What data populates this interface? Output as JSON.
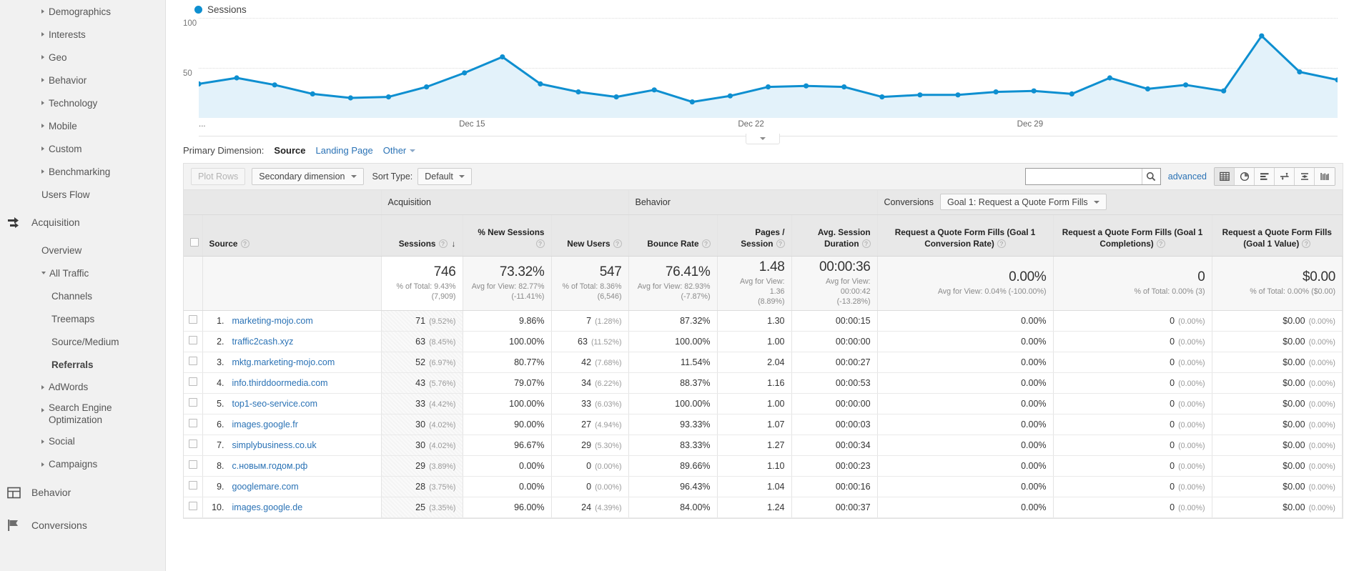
{
  "sidebar": {
    "top_items": [
      {
        "label": "Demographics",
        "arrow": "right"
      },
      {
        "label": "Interests",
        "arrow": "right"
      },
      {
        "label": "Geo",
        "arrow": "right"
      },
      {
        "label": "Behavior",
        "arrow": "right"
      },
      {
        "label": "Technology",
        "arrow": "right"
      },
      {
        "label": "Mobile",
        "arrow": "right"
      },
      {
        "label": "Custom",
        "arrow": "right"
      },
      {
        "label": "Benchmarking",
        "arrow": "right"
      }
    ],
    "users_flow": "Users Flow",
    "acquisition": {
      "label": "Acquisition",
      "icon": "acquisition-arrows-icon",
      "overview": "Overview",
      "all_traffic": "All Traffic",
      "all_traffic_children": [
        "Channels",
        "Treemaps",
        "Source/Medium",
        "Referrals"
      ],
      "active_child": "Referrals",
      "collapsed": [
        {
          "label": "AdWords"
        },
        {
          "label": "Search Engine Optimization"
        },
        {
          "label": "Social"
        },
        {
          "label": "Campaigns"
        }
      ]
    },
    "behavior": {
      "label": "Behavior",
      "icon": "behavior-layout-icon"
    },
    "conversions": {
      "label": "Conversions",
      "icon": "conversions-flag-icon"
    }
  },
  "chart_data": {
    "type": "area",
    "title": "",
    "legend": [
      "Sessions"
    ],
    "legend_position": "top-left",
    "series_color": "#0e8fd0",
    "fill_color": "#e3f2fa",
    "ylabel": "",
    "xlabel": "",
    "ylim": [
      0,
      100
    ],
    "yticks": [
      50,
      100
    ],
    "ytick_labels": [
      "50",
      "100"
    ],
    "grid": true,
    "xtick_labels": [
      "...",
      "Dec 15",
      "Dec 22",
      "Dec 29"
    ],
    "xtick_positions_pct": [
      0,
      24.0,
      48.5,
      73.0
    ],
    "x": [
      1,
      2,
      3,
      4,
      5,
      6,
      7,
      8,
      9,
      10,
      11,
      12,
      13,
      14,
      15,
      16,
      17,
      18,
      19,
      20,
      21,
      22,
      23,
      24,
      25,
      26,
      27,
      28,
      29,
      30,
      31
    ],
    "values": [
      34,
      40,
      33,
      24,
      20,
      21,
      31,
      45,
      61,
      34,
      26,
      21,
      28,
      16,
      22,
      31,
      32,
      31,
      21,
      23,
      23,
      26,
      27,
      24,
      40,
      29,
      33,
      27,
      82,
      46,
      38
    ]
  },
  "primary_dimension": {
    "label": "Primary Dimension:",
    "active": "Source",
    "links": [
      "Landing Page"
    ],
    "other": "Other"
  },
  "toolbar": {
    "plot_rows": "Plot Rows",
    "secondary_dimension": "Secondary dimension",
    "sort_type_label": "Sort Type:",
    "sort_type_value": "Default",
    "search_value": "",
    "search_placeholder": "",
    "advanced": "advanced",
    "view_icons": [
      "table-view-icon",
      "pie-chart-view-icon",
      "performance-bar-view-icon",
      "comparison-view-icon",
      "pivot-view-icon",
      "term-cloud-view-icon"
    ],
    "selected_view": "table-view-icon"
  },
  "table": {
    "group_headers": [
      {
        "label": "Acquisition"
      },
      {
        "label": "Behavior"
      },
      {
        "label": "Conversions",
        "select": "Goal 1: Request a Quote Form Fills"
      }
    ],
    "columns": [
      {
        "label": "Source",
        "help": true,
        "align": "left"
      },
      {
        "label": "Sessions",
        "help": true,
        "sorted": true
      },
      {
        "label": "% New Sessions",
        "help": true
      },
      {
        "label": "New Users",
        "help": true
      },
      {
        "label": "Bounce Rate",
        "help": true
      },
      {
        "label": "Pages / Session",
        "help": true
      },
      {
        "label": "Avg. Session Duration",
        "help": true
      },
      {
        "label": "Request a Quote Form Fills (Goal 1 Conversion Rate)",
        "help": true
      },
      {
        "label": "Request a Quote Form Fills (Goal 1 Completions)",
        "help": true
      },
      {
        "label": "Request a Quote Form Fills (Goal 1 Value)",
        "help": true
      }
    ],
    "summary": [
      {
        "value": "746",
        "sub": "% of Total: 9.43%\n(7,909)"
      },
      {
        "value": "73.32%",
        "sub": "Avg for View: 82.77%\n(-11.41%)"
      },
      {
        "value": "547",
        "sub": "% of Total: 8.36%\n(6,546)"
      },
      {
        "value": "76.41%",
        "sub": "Avg for View: 82.93%\n(-7.87%)"
      },
      {
        "value": "1.48",
        "sub": "Avg for View: 1.36\n(8.89%)"
      },
      {
        "value": "00:00:36",
        "sub": "Avg for View: 00:00:42\n(-13.28%)"
      },
      {
        "value": "0.00%",
        "sub": "Avg for View: 0.04% (-100.00%)"
      },
      {
        "value": "0",
        "sub": "% of Total: 0.00% (3)"
      },
      {
        "value": "$0.00",
        "sub": "% of Total: 0.00% ($0.00)"
      }
    ],
    "rows": [
      {
        "n": "1.",
        "source": "marketing-mojo.com",
        "sessions": "71",
        "sessions_pct": "(9.52%)",
        "new_sessions": "9.86%",
        "new_users": "7",
        "new_users_pct": "(1.28%)",
        "bounce": "87.32%",
        "pages": "1.30",
        "duration": "00:00:15",
        "goal_rate": "0.00%",
        "goal_completions": "0",
        "goal_completions_pct": "(0.00%)",
        "goal_value": "$0.00",
        "goal_value_pct": "(0.00%)"
      },
      {
        "n": "2.",
        "source": "traffic2cash.xyz",
        "sessions": "63",
        "sessions_pct": "(8.45%)",
        "new_sessions": "100.00%",
        "new_users": "63",
        "new_users_pct": "(11.52%)",
        "bounce": "100.00%",
        "pages": "1.00",
        "duration": "00:00:00",
        "goal_rate": "0.00%",
        "goal_completions": "0",
        "goal_completions_pct": "(0.00%)",
        "goal_value": "$0.00",
        "goal_value_pct": "(0.00%)"
      },
      {
        "n": "3.",
        "source": "mktg.marketing-mojo.com",
        "sessions": "52",
        "sessions_pct": "(6.97%)",
        "new_sessions": "80.77%",
        "new_users": "42",
        "new_users_pct": "(7.68%)",
        "bounce": "11.54%",
        "pages": "2.04",
        "duration": "00:00:27",
        "goal_rate": "0.00%",
        "goal_completions": "0",
        "goal_completions_pct": "(0.00%)",
        "goal_value": "$0.00",
        "goal_value_pct": "(0.00%)"
      },
      {
        "n": "4.",
        "source": "info.thirddoormedia.com",
        "sessions": "43",
        "sessions_pct": "(5.76%)",
        "new_sessions": "79.07%",
        "new_users": "34",
        "new_users_pct": "(6.22%)",
        "bounce": "88.37%",
        "pages": "1.16",
        "duration": "00:00:53",
        "goal_rate": "0.00%",
        "goal_completions": "0",
        "goal_completions_pct": "(0.00%)",
        "goal_value": "$0.00",
        "goal_value_pct": "(0.00%)"
      },
      {
        "n": "5.",
        "source": "top1-seo-service.com",
        "sessions": "33",
        "sessions_pct": "(4.42%)",
        "new_sessions": "100.00%",
        "new_users": "33",
        "new_users_pct": "(6.03%)",
        "bounce": "100.00%",
        "pages": "1.00",
        "duration": "00:00:00",
        "goal_rate": "0.00%",
        "goal_completions": "0",
        "goal_completions_pct": "(0.00%)",
        "goal_value": "$0.00",
        "goal_value_pct": "(0.00%)"
      },
      {
        "n": "6.",
        "source": "images.google.fr",
        "sessions": "30",
        "sessions_pct": "(4.02%)",
        "new_sessions": "90.00%",
        "new_users": "27",
        "new_users_pct": "(4.94%)",
        "bounce": "93.33%",
        "pages": "1.07",
        "duration": "00:00:03",
        "goal_rate": "0.00%",
        "goal_completions": "0",
        "goal_completions_pct": "(0.00%)",
        "goal_value": "$0.00",
        "goal_value_pct": "(0.00%)"
      },
      {
        "n": "7.",
        "source": "simplybusiness.co.uk",
        "sessions": "30",
        "sessions_pct": "(4.02%)",
        "new_sessions": "96.67%",
        "new_users": "29",
        "new_users_pct": "(5.30%)",
        "bounce": "83.33%",
        "pages": "1.27",
        "duration": "00:00:34",
        "goal_rate": "0.00%",
        "goal_completions": "0",
        "goal_completions_pct": "(0.00%)",
        "goal_value": "$0.00",
        "goal_value_pct": "(0.00%)"
      },
      {
        "n": "8.",
        "source": "с.новым.годом.рф",
        "sessions": "29",
        "sessions_pct": "(3.89%)",
        "new_sessions": "0.00%",
        "new_users": "0",
        "new_users_pct": "(0.00%)",
        "bounce": "89.66%",
        "pages": "1.10",
        "duration": "00:00:23",
        "goal_rate": "0.00%",
        "goal_completions": "0",
        "goal_completions_pct": "(0.00%)",
        "goal_value": "$0.00",
        "goal_value_pct": "(0.00%)"
      },
      {
        "n": "9.",
        "source": "googlemare.com",
        "sessions": "28",
        "sessions_pct": "(3.75%)",
        "new_sessions": "0.00%",
        "new_users": "0",
        "new_users_pct": "(0.00%)",
        "bounce": "96.43%",
        "pages": "1.04",
        "duration": "00:00:16",
        "goal_rate": "0.00%",
        "goal_completions": "0",
        "goal_completions_pct": "(0.00%)",
        "goal_value": "$0.00",
        "goal_value_pct": "(0.00%)"
      },
      {
        "n": "10.",
        "source": "images.google.de",
        "sessions": "25",
        "sessions_pct": "(3.35%)",
        "new_sessions": "96.00%",
        "new_users": "24",
        "new_users_pct": "(4.39%)",
        "bounce": "84.00%",
        "pages": "1.24",
        "duration": "00:00:37",
        "goal_rate": "0.00%",
        "goal_completions": "0",
        "goal_completions_pct": "(0.00%)",
        "goal_value": "$0.00",
        "goal_value_pct": "(0.00%)"
      }
    ]
  }
}
